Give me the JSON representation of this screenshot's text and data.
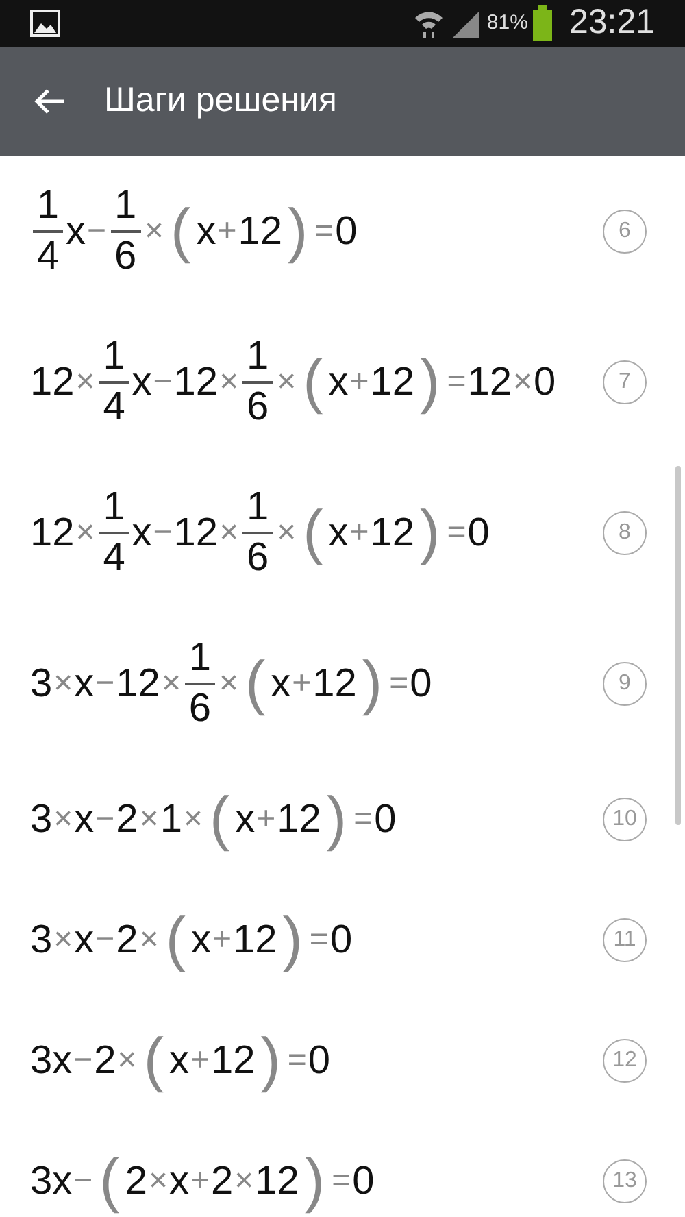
{
  "status_bar": {
    "battery": "81%",
    "time": "23:21"
  },
  "toolbar": {
    "title": "Шаги решения"
  },
  "steps": [
    {
      "number": "6",
      "parts": [
        {
          "kind": "frac",
          "num": "1",
          "den": "4"
        },
        {
          "kind": "term",
          "text": "x"
        },
        {
          "kind": "op",
          "text": "−"
        },
        {
          "kind": "frac",
          "num": "1",
          "den": "6"
        },
        {
          "kind": "op",
          "text": "×"
        },
        {
          "kind": "paren",
          "text": "("
        },
        {
          "kind": "term",
          "text": "x"
        },
        {
          "kind": "op",
          "text": "+"
        },
        {
          "kind": "term",
          "text": "12"
        },
        {
          "kind": "paren",
          "text": ")"
        },
        {
          "kind": "op",
          "text": "="
        },
        {
          "kind": "term",
          "text": "0"
        }
      ]
    },
    {
      "number": "7",
      "parts": [
        {
          "kind": "term",
          "text": "12"
        },
        {
          "kind": "op",
          "text": "×"
        },
        {
          "kind": "frac",
          "num": "1",
          "den": "4"
        },
        {
          "kind": "term",
          "text": "x"
        },
        {
          "kind": "op",
          "text": "−"
        },
        {
          "kind": "term",
          "text": "12"
        },
        {
          "kind": "op",
          "text": "×"
        },
        {
          "kind": "frac",
          "num": "1",
          "den": "6"
        },
        {
          "kind": "op",
          "text": "×"
        },
        {
          "kind": "paren",
          "text": "("
        },
        {
          "kind": "term",
          "text": "x"
        },
        {
          "kind": "op",
          "text": "+"
        },
        {
          "kind": "term",
          "text": "12"
        },
        {
          "kind": "paren",
          "text": ")"
        },
        {
          "kind": "op",
          "text": "="
        },
        {
          "kind": "term",
          "text": "12"
        },
        {
          "kind": "op",
          "text": "×"
        },
        {
          "kind": "term",
          "text": "0"
        }
      ]
    },
    {
      "number": "8",
      "parts": [
        {
          "kind": "term",
          "text": "12"
        },
        {
          "kind": "op",
          "text": "×"
        },
        {
          "kind": "frac",
          "num": "1",
          "den": "4"
        },
        {
          "kind": "term",
          "text": "x"
        },
        {
          "kind": "op",
          "text": "−"
        },
        {
          "kind": "term",
          "text": "12"
        },
        {
          "kind": "op",
          "text": "×"
        },
        {
          "kind": "frac",
          "num": "1",
          "den": "6"
        },
        {
          "kind": "op",
          "text": "×"
        },
        {
          "kind": "paren",
          "text": "("
        },
        {
          "kind": "term",
          "text": "x"
        },
        {
          "kind": "op",
          "text": "+"
        },
        {
          "kind": "term",
          "text": "12"
        },
        {
          "kind": "paren",
          "text": ")"
        },
        {
          "kind": "op",
          "text": "="
        },
        {
          "kind": "term",
          "text": "0"
        }
      ]
    },
    {
      "number": "9",
      "parts": [
        {
          "kind": "term",
          "text": "3"
        },
        {
          "kind": "op",
          "text": "×"
        },
        {
          "kind": "term",
          "text": "x"
        },
        {
          "kind": "op",
          "text": "−"
        },
        {
          "kind": "term",
          "text": "12"
        },
        {
          "kind": "op",
          "text": "×"
        },
        {
          "kind": "frac",
          "num": "1",
          "den": "6"
        },
        {
          "kind": "op",
          "text": "×"
        },
        {
          "kind": "paren",
          "text": "("
        },
        {
          "kind": "term",
          "text": "x"
        },
        {
          "kind": "op",
          "text": "+"
        },
        {
          "kind": "term",
          "text": "12"
        },
        {
          "kind": "paren",
          "text": ")"
        },
        {
          "kind": "op",
          "text": "="
        },
        {
          "kind": "term",
          "text": "0"
        }
      ]
    },
    {
      "number": "10",
      "parts": [
        {
          "kind": "term",
          "text": "3"
        },
        {
          "kind": "op",
          "text": "×"
        },
        {
          "kind": "term",
          "text": "x"
        },
        {
          "kind": "op",
          "text": "−"
        },
        {
          "kind": "term",
          "text": "2"
        },
        {
          "kind": "op",
          "text": "×"
        },
        {
          "kind": "term",
          "text": "1"
        },
        {
          "kind": "op",
          "text": "×"
        },
        {
          "kind": "paren",
          "text": "("
        },
        {
          "kind": "term",
          "text": "x"
        },
        {
          "kind": "op",
          "text": "+"
        },
        {
          "kind": "term",
          "text": "12"
        },
        {
          "kind": "paren",
          "text": ")"
        },
        {
          "kind": "op",
          "text": "="
        },
        {
          "kind": "term",
          "text": "0"
        }
      ]
    },
    {
      "number": "11",
      "parts": [
        {
          "kind": "term",
          "text": "3"
        },
        {
          "kind": "op",
          "text": "×"
        },
        {
          "kind": "term",
          "text": "x"
        },
        {
          "kind": "op",
          "text": "−"
        },
        {
          "kind": "term",
          "text": "2"
        },
        {
          "kind": "op",
          "text": "×"
        },
        {
          "kind": "paren",
          "text": "("
        },
        {
          "kind": "term",
          "text": "x"
        },
        {
          "kind": "op",
          "text": "+"
        },
        {
          "kind": "term",
          "text": "12"
        },
        {
          "kind": "paren",
          "text": ")"
        },
        {
          "kind": "op",
          "text": "="
        },
        {
          "kind": "term",
          "text": "0"
        }
      ]
    },
    {
      "number": "12",
      "parts": [
        {
          "kind": "term",
          "text": "3x"
        },
        {
          "kind": "op",
          "text": "−"
        },
        {
          "kind": "term",
          "text": "2"
        },
        {
          "kind": "op",
          "text": "×"
        },
        {
          "kind": "paren",
          "text": "("
        },
        {
          "kind": "term",
          "text": "x"
        },
        {
          "kind": "op",
          "text": "+"
        },
        {
          "kind": "term",
          "text": "12"
        },
        {
          "kind": "paren",
          "text": ")"
        },
        {
          "kind": "op",
          "text": "="
        },
        {
          "kind": "term",
          "text": "0"
        }
      ]
    },
    {
      "number": "13",
      "parts": [
        {
          "kind": "term",
          "text": "3x"
        },
        {
          "kind": "op",
          "text": "−"
        },
        {
          "kind": "paren",
          "text": "("
        },
        {
          "kind": "term",
          "text": "2"
        },
        {
          "kind": "op",
          "text": "×"
        },
        {
          "kind": "term",
          "text": "x"
        },
        {
          "kind": "op",
          "text": "+"
        },
        {
          "kind": "term",
          "text": "2"
        },
        {
          "kind": "op",
          "text": "×"
        },
        {
          "kind": "term",
          "text": "12"
        },
        {
          "kind": "paren",
          "text": ")"
        },
        {
          "kind": "op",
          "text": "="
        },
        {
          "kind": "term",
          "text": "0"
        }
      ]
    }
  ]
}
